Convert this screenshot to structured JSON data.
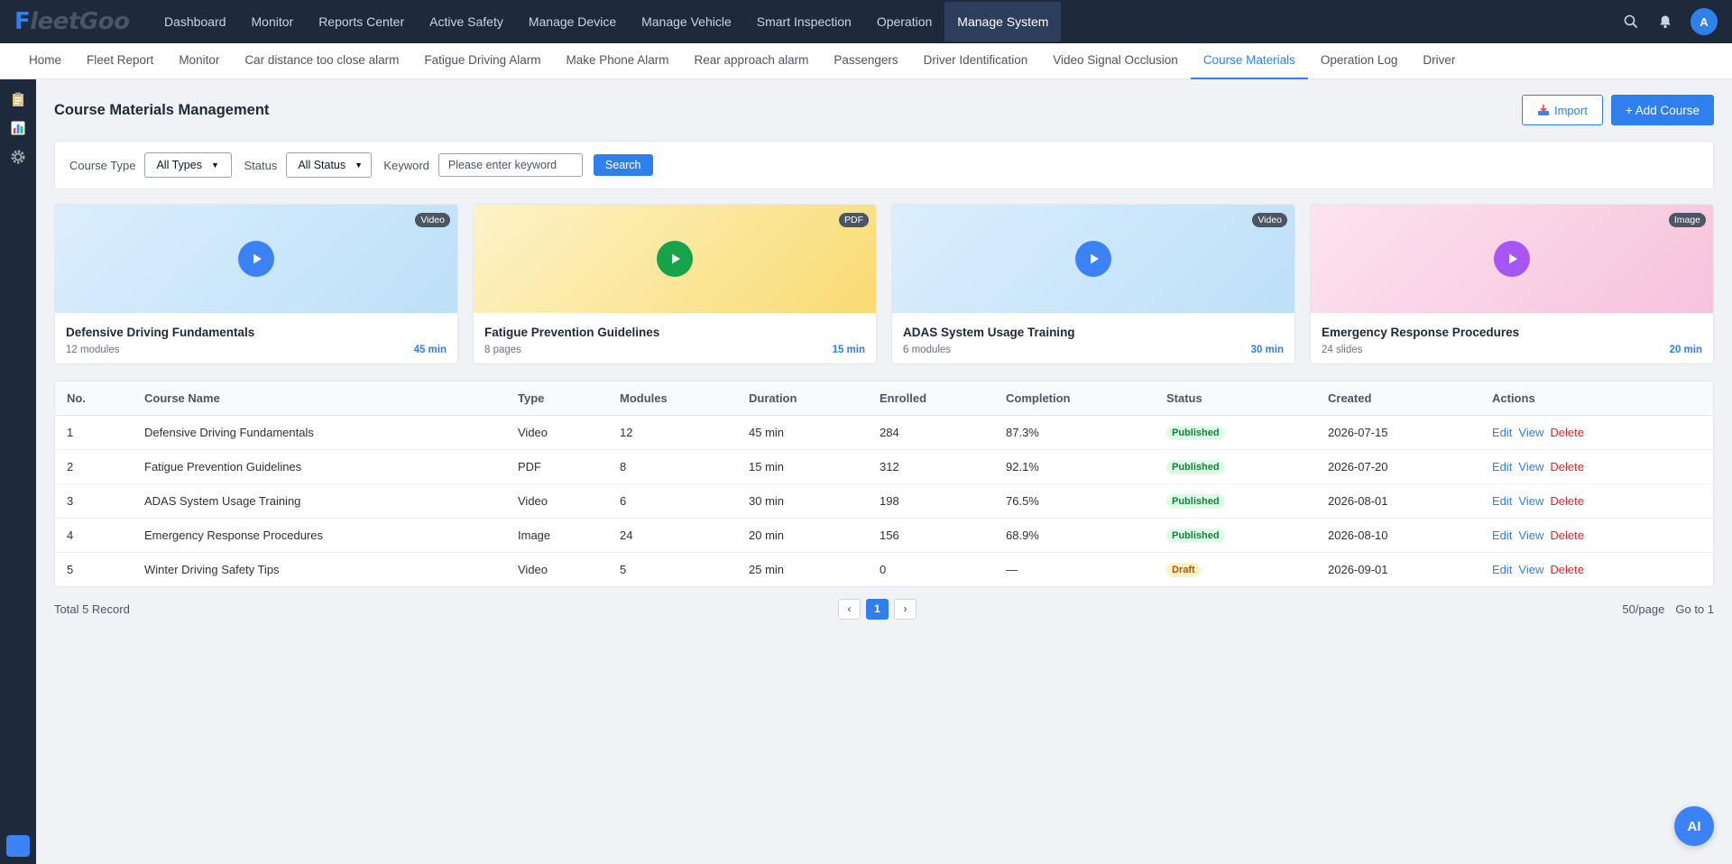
{
  "app": {
    "logo_first": "F",
    "logo_rest": "leetGoo"
  },
  "nav": [
    "Dashboard",
    "Monitor",
    "Reports Center",
    "Active Safety",
    "Manage Device",
    "Manage Vehicle",
    "Smart Inspection",
    "Operation",
    "Manage System"
  ],
  "nav_active": "Manage System",
  "user": {
    "avatar_letter": "A"
  },
  "tabs": [
    "Home",
    "Fleet Report",
    "Monitor",
    "Car distance too close alarm",
    "Fatigue Driving Alarm",
    "Make Phone Alarm",
    "Rear approach alarm",
    "Passengers",
    "Driver Identification",
    "Video Signal Occlusion",
    "Course Materials",
    "Operation Log",
    "Driver"
  ],
  "tab_active": "Course Materials",
  "page": {
    "title": "Course Materials Management",
    "import_label": "Import",
    "add_label": "+ Add Course"
  },
  "filter": {
    "course_type_label": "Course Type",
    "course_type_value": "All Types",
    "status_label": "Status",
    "status_value": "All Status",
    "keyword_label": "Keyword",
    "keyword_placeholder": "Please enter keyword",
    "search_label": "Search"
  },
  "cards": [
    {
      "badge": "Video",
      "title": "Defensive Driving Fundamentals",
      "sub": "12 modules",
      "duration": "45 min",
      "bg_from": "#dbeefd",
      "bg_to": "#bde0f8",
      "play": "#3b82f6"
    },
    {
      "badge": "PDF",
      "title": "Fatigue Prevention Guidelines",
      "sub": "8 pages",
      "duration": "15 min",
      "bg_from": "#fdf3c8",
      "bg_to": "#f9db72",
      "play": "#16a34a"
    },
    {
      "badge": "Video",
      "title": "ADAS System Usage Training",
      "sub": "6 modules",
      "duration": "30 min",
      "bg_from": "#dbeefd",
      "bg_to": "#bde0f8",
      "play": "#3b82f6"
    },
    {
      "badge": "Image",
      "title": "Emergency Response Procedures",
      "sub": "24 slides",
      "duration": "20 min",
      "bg_from": "#fce3ef",
      "bg_to": "#f7c2dc",
      "play": "#a855f7"
    }
  ],
  "table": {
    "headers": [
      "No.",
      "Course Name",
      "Type",
      "Modules",
      "Duration",
      "Enrolled",
      "Completion",
      "Status",
      "Created",
      "Actions"
    ],
    "rows": [
      {
        "no": "1",
        "name": "Defensive Driving Fundamentals",
        "type": "Video",
        "modules": "12",
        "duration": "45 min",
        "enrolled": "284",
        "completion": "87.3%",
        "status": "Published",
        "status_kind": "pub",
        "created": "2026-07-15"
      },
      {
        "no": "2",
        "name": "Fatigue Prevention Guidelines",
        "type": "PDF",
        "modules": "8",
        "duration": "15 min",
        "enrolled": "312",
        "completion": "92.1%",
        "status": "Published",
        "status_kind": "pub",
        "created": "2026-07-20"
      },
      {
        "no": "3",
        "name": "ADAS System Usage Training",
        "type": "Video",
        "modules": "6",
        "duration": "30 min",
        "enrolled": "198",
        "completion": "76.5%",
        "status": "Published",
        "status_kind": "pub",
        "created": "2026-08-01"
      },
      {
        "no": "4",
        "name": "Emergency Response Procedures",
        "type": "Image",
        "modules": "24",
        "duration": "20 min",
        "enrolled": "156",
        "completion": "68.9%",
        "status": "Published",
        "status_kind": "pub",
        "created": "2026-08-10"
      },
      {
        "no": "5",
        "name": "Winter Driving Safety Tips",
        "type": "Video",
        "modules": "5",
        "duration": "25 min",
        "enrolled": "0",
        "completion": "—",
        "status": "Draft",
        "status_kind": "draft",
        "created": "2026-09-01"
      }
    ],
    "actions": [
      "Edit",
      "View",
      "Delete"
    ]
  },
  "pager": {
    "total": "Total 5 Record",
    "prev": "‹",
    "current": "1",
    "next": "›",
    "per_page": "50/page",
    "goto": "Go to 1"
  },
  "ai_label": "AI"
}
